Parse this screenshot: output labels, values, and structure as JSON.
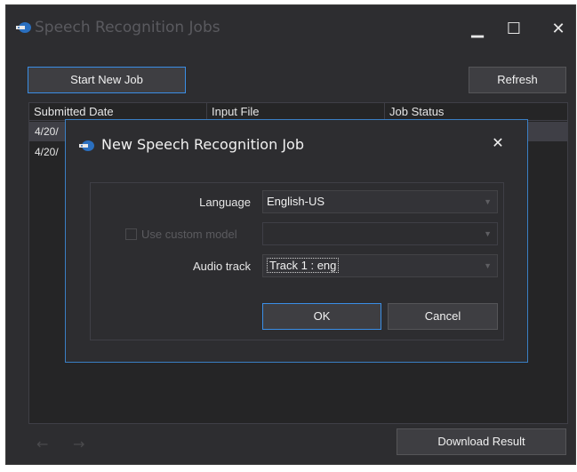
{
  "window": {
    "title": "Speech Recognition Jobs",
    "minimize_glyph": "▁",
    "maximize_glyph": "☐",
    "close_glyph": "✕"
  },
  "toolbar": {
    "start_new_job": "Start New Job",
    "refresh": "Refresh"
  },
  "grid": {
    "columns": [
      "Submitted Date",
      "Input File",
      "Job Status"
    ],
    "rows": [
      "4/20/",
      "4/20/"
    ]
  },
  "footer": {
    "back_glyph": "←",
    "forward_glyph": "→",
    "download_result": "Download Result"
  },
  "dialog": {
    "title": "New Speech Recognition Job",
    "close_glyph": "✕",
    "language_label": "Language",
    "language_value": "English-US",
    "use_custom_model_label": "Use custom model",
    "custom_model_value": "",
    "audio_track_label": "Audio track",
    "audio_track_value": "Track 1 : eng",
    "ok": "OK",
    "cancel": "Cancel",
    "dropdown_glyph": "▼"
  },
  "colors": {
    "window_bg": "#2d2d30",
    "accent": "#3a8ee6"
  }
}
